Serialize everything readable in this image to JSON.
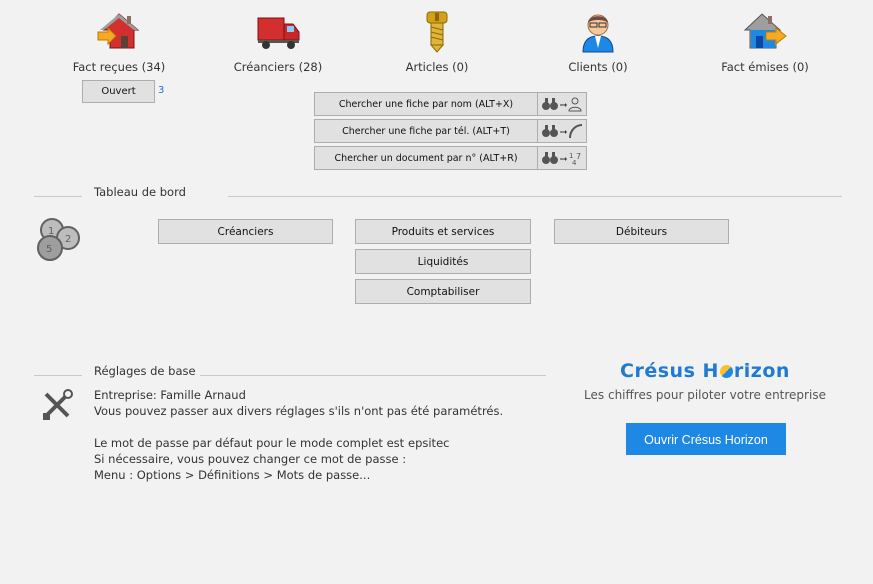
{
  "nav": [
    {
      "label": "Fact reçues (34)",
      "icon": "house-arrow-in-icon"
    },
    {
      "label": "Créanciers (28)",
      "icon": "truck-icon"
    },
    {
      "label": "Articles (0)",
      "icon": "screw-icon"
    },
    {
      "label": "Clients (0)",
      "icon": "person-icon"
    },
    {
      "label": "Fact émises (0)",
      "icon": "house-arrow-out-icon"
    }
  ],
  "open_button": {
    "label": "Ouvert",
    "count": "3"
  },
  "search": [
    {
      "label": "Chercher une fiche par nom (ALT+X)",
      "icon": "binoculars-person-icon"
    },
    {
      "label": "Chercher une fiche par tél. (ALT+T)",
      "icon": "binoculars-phone-icon"
    },
    {
      "label": "Chercher un document par n° (ALT+R)",
      "icon": "binoculars-number-icon"
    }
  ],
  "dashboard": {
    "title": "Tableau de bord",
    "icon": "coins-icon",
    "creanciers": "Créanciers",
    "produits": "Produits et services",
    "debiteurs": "Débiteurs",
    "liquidites": "Liquidités",
    "comptabiliser": "Comptabiliser"
  },
  "settings": {
    "title": "Réglages de base",
    "icon": "tools-icon",
    "company": "Entreprise: Famille Arnaud",
    "line2": "Vous pouvez passer aux divers réglages s'ils n'ont pas été paramétrés.",
    "pw_line": "Le mot de passe par défaut pour le mode complet est",
    "pw_value": "epsitec",
    "line4": "Si nécessaire, vous pouvez changer ce mot de passe :",
    "line5": "Menu : Options > Définitions > Mots de passe..."
  },
  "horizon": {
    "title_pre": "Crésus H",
    "title_post": "rizon",
    "subtitle": "Les chiffres pour piloter votre entreprise",
    "button": "Ouvrir Crésus Horizon"
  },
  "colors": {
    "accent": "#1e88e5",
    "brand": "#1e7bd1"
  }
}
